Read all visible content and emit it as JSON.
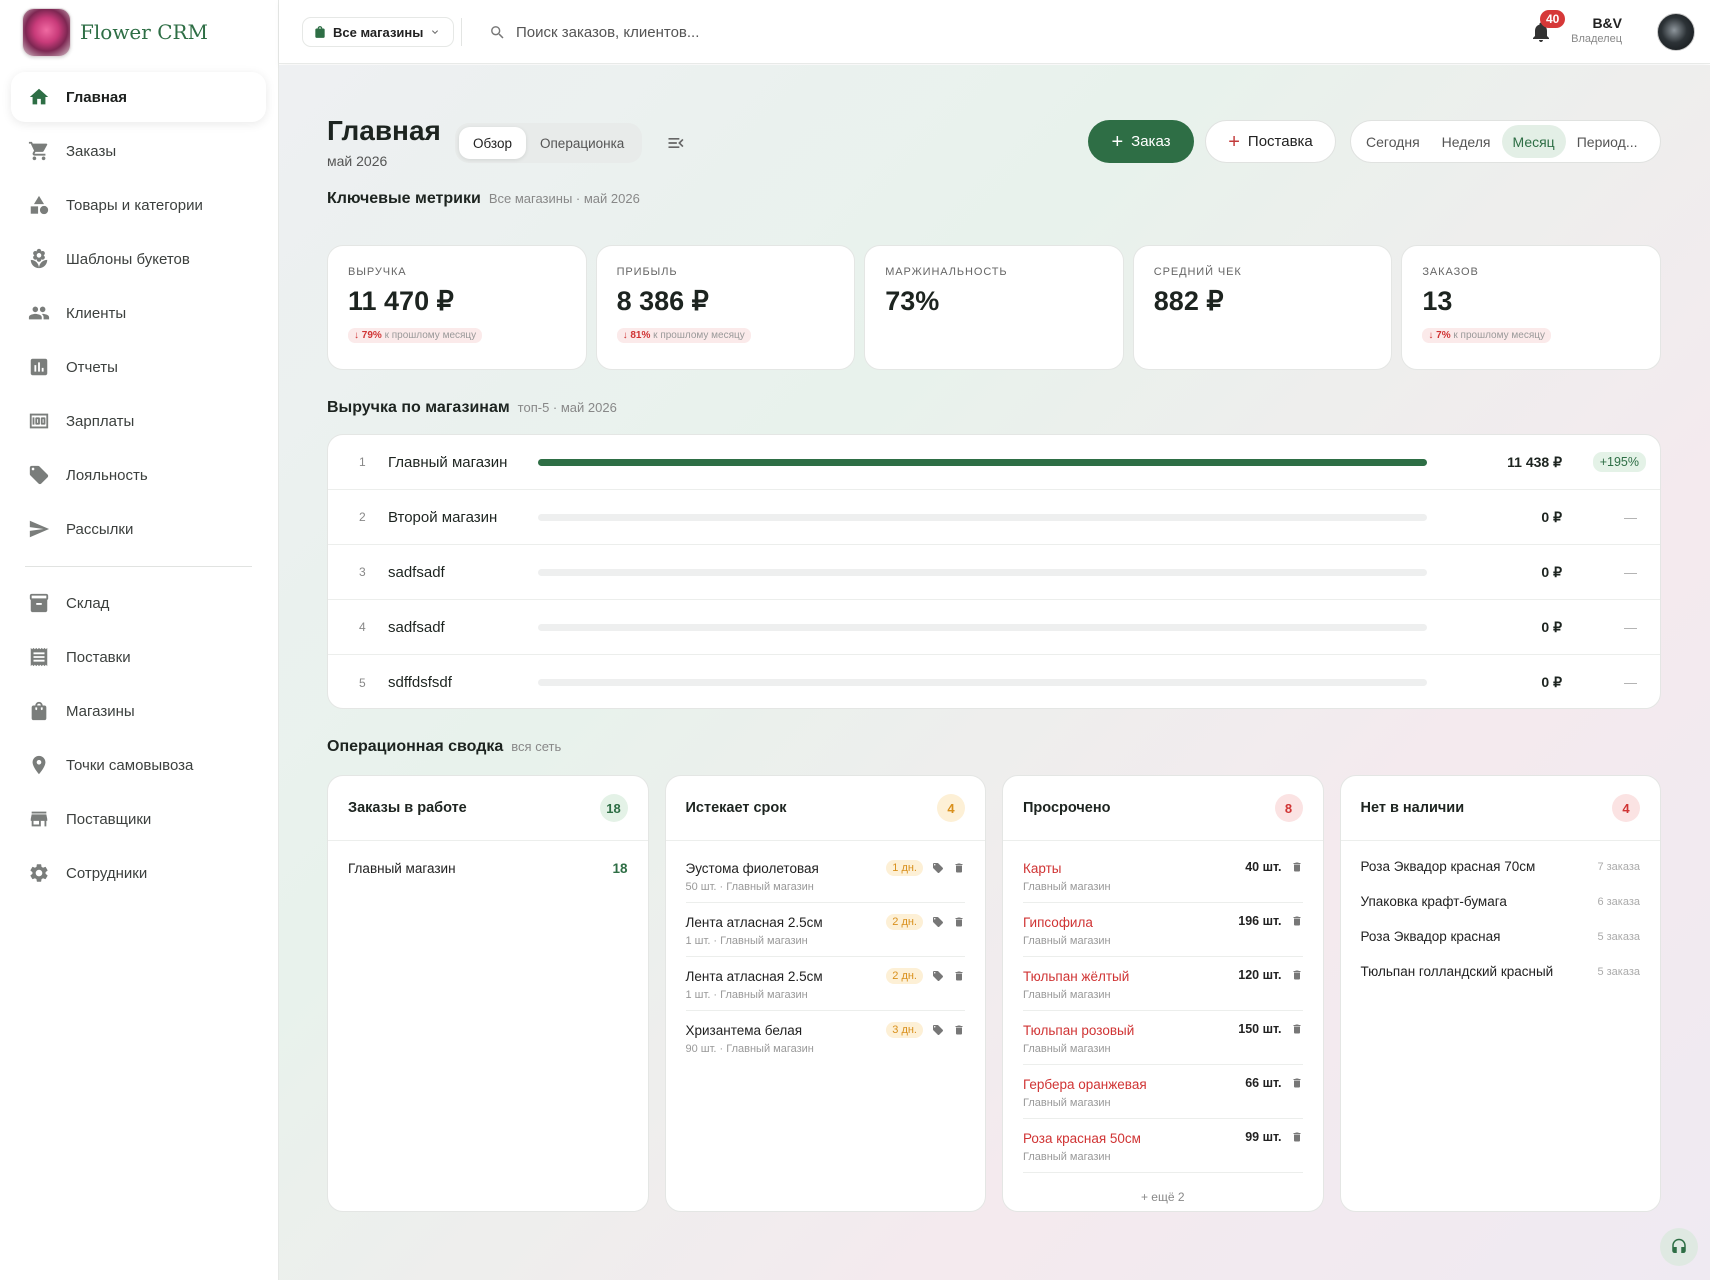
{
  "app": {
    "title": "Flower CRM"
  },
  "sidebar": {
    "items": [
      {
        "label": "Главная",
        "icon": "home-icon"
      },
      {
        "label": "Заказы",
        "icon": "cart-icon"
      },
      {
        "label": "Товары и категории",
        "icon": "category-icon"
      },
      {
        "label": "Шаблоны букетов",
        "icon": "flower-icon"
      },
      {
        "label": "Клиенты",
        "icon": "people-icon"
      },
      {
        "label": "Отчеты",
        "icon": "chart-icon"
      },
      {
        "label": "Зарплаты",
        "icon": "money-icon"
      },
      {
        "label": "Лояльность",
        "icon": "tag-icon"
      },
      {
        "label": "Рассылки",
        "icon": "send-icon"
      },
      {
        "label": "Склад",
        "icon": "archive-icon"
      },
      {
        "label": "Поставки",
        "icon": "receipt-icon"
      },
      {
        "label": "Магазины",
        "icon": "bag-icon"
      },
      {
        "label": "Точки самовывоза",
        "icon": "pin-icon"
      },
      {
        "label": "Поставщики",
        "icon": "store-icon"
      },
      {
        "label": "Сотрудники",
        "icon": "gear-icon"
      }
    ]
  },
  "topbar": {
    "store_select": "Все магазины",
    "search_placeholder": "Поиск заказов, клиентов...",
    "notifications": "40",
    "user_name": "B&V",
    "user_role": "Владелец"
  },
  "page": {
    "title": "Главная",
    "subtitle": "май 2026",
    "tabs": [
      "Обзор",
      "Операционка"
    ],
    "btn_order": "Заказ",
    "btn_supply": "Поставка",
    "periods": [
      "Сегодня",
      "Неделя",
      "Месяц",
      "Период..."
    ]
  },
  "metrics": {
    "title": "Ключевые метрики",
    "meta": "Все магазины · май 2026",
    "cards": [
      {
        "label": "ВЫРУЧКА",
        "value": "11 470 ₽",
        "delta": "↓ 79%",
        "delta_note": "к прошлому месяцу"
      },
      {
        "label": "ПРИБЫЛЬ",
        "value": "8 386 ₽",
        "delta": "↓ 81%",
        "delta_note": "к прошлому месяцу"
      },
      {
        "label": "МАРЖИНАЛЬНОСТЬ",
        "value": "73%"
      },
      {
        "label": "СРЕДНИЙ ЧЕК",
        "value": "882 ₽"
      },
      {
        "label": "ЗАКАЗОВ",
        "value": "13",
        "delta": "↓ 7%",
        "delta_note": "к прошлому месяцу"
      }
    ]
  },
  "revenue": {
    "title": "Выручка по магазинам",
    "meta": "топ-5 · май 2026",
    "rows": [
      {
        "rank": "1",
        "name": "Главный магазин",
        "value": "11 438 ₽",
        "share": 1.0,
        "delta": "+195%"
      },
      {
        "rank": "2",
        "name": "Второй магазин",
        "value": "0 ₽",
        "share": 0,
        "delta": "—"
      },
      {
        "rank": "3",
        "name": "sadfsadf",
        "value": "0 ₽",
        "share": 0,
        "delta": "—"
      },
      {
        "rank": "4",
        "name": "sadfsadf",
        "value": "0 ₽",
        "share": 0,
        "delta": "—"
      },
      {
        "rank": "5",
        "name": "sdffdsfsdf",
        "value": "0 ₽",
        "share": 0,
        "delta": "—"
      }
    ]
  },
  "ops": {
    "title": "Операционная сводка",
    "meta": "вся сеть",
    "in_work": {
      "title": "Заказы в работе",
      "count": "18",
      "rows": [
        {
          "name": "Главный магазин",
          "value": "18"
        }
      ]
    },
    "expiring": {
      "title": "Истекает срок",
      "count": "4",
      "rows": [
        {
          "name": "Эустома фиолетовая",
          "sub": "50 шт. · Главный магазин",
          "days": "1 дн."
        },
        {
          "name": "Лента атласная 2.5см",
          "sub": "1 шт. · Главный магазин",
          "days": "2 дн."
        },
        {
          "name": "Лента атласная 2.5см",
          "sub": "1 шт. · Главный магазин",
          "days": "2 дн."
        },
        {
          "name": "Хризантема белая",
          "sub": "90 шт. · Главный магазин",
          "days": "3 дн."
        }
      ]
    },
    "overdue": {
      "title": "Просрочено",
      "count": "8",
      "more": "+ ещё 2",
      "rows": [
        {
          "name": "Карты",
          "sub": "Главный магазин",
          "qty": "40 шт."
        },
        {
          "name": "Гипсофила",
          "sub": "Главный магазин",
          "qty": "196 шт."
        },
        {
          "name": "Тюльпан жёлтый",
          "sub": "Главный магазин",
          "qty": "120 шт."
        },
        {
          "name": "Тюльпан розовый",
          "sub": "Главный магазин",
          "qty": "150 шт."
        },
        {
          "name": "Гербера оранжевая",
          "sub": "Главный магазин",
          "qty": "66 шт."
        },
        {
          "name": "Роза красная 50см",
          "sub": "Главный магазин",
          "qty": "99 шт."
        }
      ]
    },
    "out_of_stock": {
      "title": "Нет в наличии",
      "count": "4",
      "rows": [
        {
          "name": "Роза Эквадор красная 70см",
          "note": "7 заказа"
        },
        {
          "name": "Упаковка крафт-бумага",
          "note": "6 заказа"
        },
        {
          "name": "Роза Эквадор красная",
          "note": "5 заказа"
        },
        {
          "name": "Тюльпан голландский красный",
          "note": "5 заказа"
        }
      ]
    }
  },
  "colors": {
    "accent": "#2e6e45",
    "danger": "#d03434",
    "warning": "#d9901c"
  }
}
